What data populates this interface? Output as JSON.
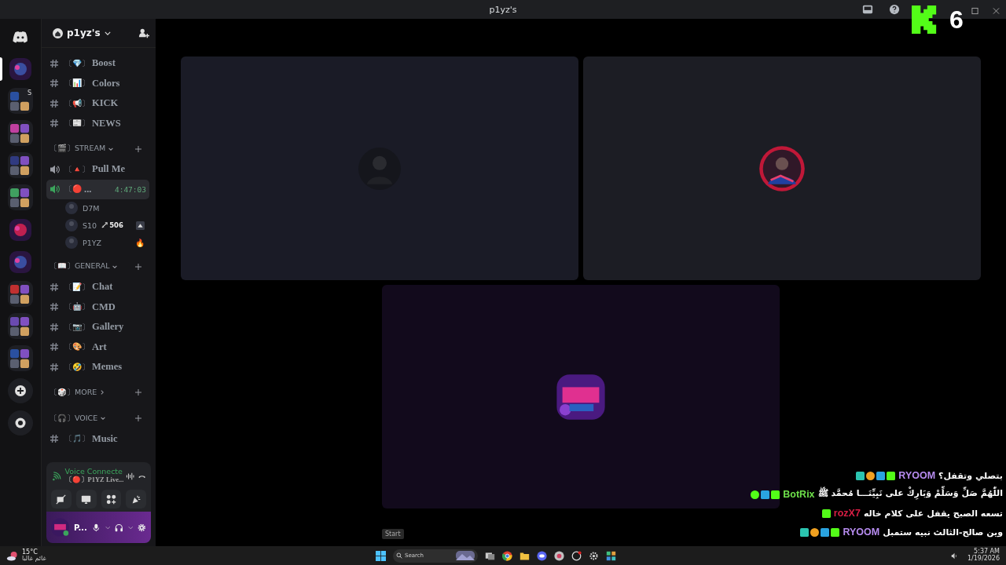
{
  "window": {
    "title": "p1yz's"
  },
  "overlay_badge": {
    "count": "6"
  },
  "rail": [
    {
      "kind": "logo",
      "selected": false
    },
    {
      "kind": "server",
      "selected": true
    },
    {
      "kind": "folder",
      "label": "S",
      "selected": false
    },
    {
      "kind": "folder",
      "selected": false
    },
    {
      "kind": "folder",
      "selected": false
    },
    {
      "kind": "folder",
      "selected": false
    },
    {
      "kind": "server",
      "selected": false
    },
    {
      "kind": "server",
      "selected": false
    },
    {
      "kind": "folder",
      "selected": false
    },
    {
      "kind": "folder",
      "selected": false
    },
    {
      "kind": "folder",
      "selected": false
    },
    {
      "kind": "add",
      "selected": false
    },
    {
      "kind": "discover",
      "selected": false
    }
  ],
  "server": {
    "name": "p1yz's"
  },
  "channels": [
    {
      "kind": "text",
      "name": "Boost",
      "emoji": "〔💎〕"
    },
    {
      "kind": "text",
      "name": "Colors",
      "emoji": "〔📊〕"
    },
    {
      "kind": "text",
      "name": "KICK",
      "emoji": "〔📢〕"
    },
    {
      "kind": "text",
      "name": "NEWS",
      "emoji": "〔📰〕"
    },
    {
      "kind": "category",
      "name": "STREAM",
      "emoji": "〔🎬〕",
      "expanded": true
    },
    {
      "kind": "voice",
      "name": "Pull Me",
      "emoji": "〔🔺〕",
      "selected": false
    },
    {
      "kind": "voice",
      "name": "...",
      "emoji": "〔🔴",
      "time": "4:47:03",
      "selected": true
    },
    {
      "kind": "member",
      "name": "D7M"
    },
    {
      "kind": "member",
      "name": "S10",
      "badge": "506"
    },
    {
      "kind": "member",
      "name": "P1YZ",
      "status": "🔥"
    },
    {
      "kind": "category",
      "name": "GENERAL",
      "emoji": "〔📖〕",
      "expanded": true
    },
    {
      "kind": "text",
      "name": "Chat",
      "emoji": "〔📝〕"
    },
    {
      "kind": "text",
      "name": "CMD",
      "emoji": "〔🤖〕"
    },
    {
      "kind": "text",
      "name": "Gallery",
      "emoji": "〔📷〕"
    },
    {
      "kind": "text",
      "name": "Art",
      "emoji": "〔🎨〕"
    },
    {
      "kind": "text",
      "name": "Memes",
      "emoji": "〔🤣〕"
    },
    {
      "kind": "category",
      "name": "MORE",
      "emoji": "〔🎲〕",
      "expanded": false
    },
    {
      "kind": "category",
      "name": "VOICE",
      "emoji": "〔🎧〕",
      "expanded": true
    },
    {
      "kind": "text",
      "name": "Music",
      "emoji": "〔🎵〕"
    }
  ],
  "voice_panel": {
    "status": "Voice Connecte",
    "channel": "〔🔴〕P1YZ Live..."
  },
  "user": {
    "name": "P..."
  },
  "tiles": [
    {
      "kind": "dark"
    },
    {
      "kind": "red"
    },
    {
      "kind": "logo"
    }
  ],
  "tooltip": "Start",
  "chat": [
    {
      "user": "RYOOM",
      "color": "#b78cf0",
      "badges": [
        {
          "kind": "kick"
        },
        {
          "kind": "mod"
        },
        {
          "kind": "sub"
        },
        {
          "kind": "founder"
        }
      ],
      "text": "بتصلي وتقفل؟"
    },
    {
      "user": "BotRix",
      "color": "#6ee04a",
      "badges": [
        {
          "kind": "kick"
        },
        {
          "kind": "mod"
        },
        {
          "kind": "verified"
        }
      ],
      "text": "اللّٰهُمَّ صَلِّ وَسَلِّمْ وَبَارِكْ على نَبِيِّنَـــا مُحمَّد ﷺ"
    },
    {
      "user": "rozX7",
      "color": "#d81e44",
      "badges": [
        {
          "kind": "kick"
        }
      ],
      "text": "تسعه الصبح يقفل على كلام خاله"
    },
    {
      "user": "RYOOM",
      "color": "#b78cf0",
      "badges": [
        {
          "kind": "kick"
        },
        {
          "kind": "mod"
        },
        {
          "kind": "sub"
        },
        {
          "kind": "founder"
        }
      ],
      "text": "وين صالح-الثالث نبيه ستمبل"
    }
  ],
  "taskbar": {
    "temperature": "15°C",
    "weather": "غائم غالبا",
    "search": {
      "placeholder": "Search"
    },
    "time": "5:37 AM",
    "date": "1/19/2026"
  }
}
